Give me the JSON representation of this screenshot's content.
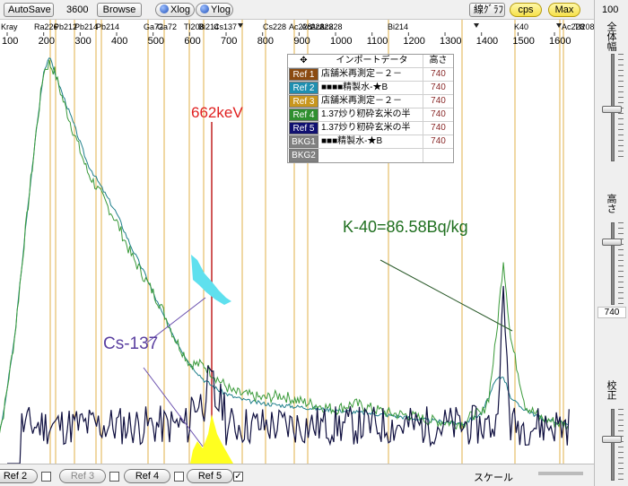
{
  "toolbar": {
    "autosave": "AutoSave",
    "time_value": "3600",
    "browse": "Browse",
    "xlog": "Xlog",
    "ylog": "Ylog",
    "line_graph": "線ｸﾞﾗﾌ",
    "cps": "cps",
    "max": "Max"
  },
  "axis": {
    "ticks": [
      "100",
      "200",
      "300",
      "400",
      "500",
      "600",
      "700",
      "800",
      "900",
      "1000",
      "1100",
      "1200",
      "1300",
      "1400",
      "1500",
      "1600"
    ],
    "top_labels": [
      "Kray",
      "Ra226",
      "Pb212",
      "Pb214",
      "Pb214",
      "Ga72",
      "Ga72",
      "Tl208",
      "Bi214",
      "Cs137",
      "Cs228",
      "Ac228",
      "Ac228",
      "Ac228",
      "Ac228",
      "Bi214",
      "K40",
      "Ac228",
      "Tl208"
    ]
  },
  "table": {
    "header": {
      "col0": "✥",
      "col1": "インポートデータ",
      "col2": "高さ"
    },
    "rows": [
      {
        "ref": "Ref 1",
        "name": "店舗米再測定－２－",
        "height": "740",
        "color": "#8b4a10"
      },
      {
        "ref": "Ref 2",
        "name": "■■■■精製水-★B",
        "height": "740",
        "color": "#1f8fb0"
      },
      {
        "ref": "Ref 3",
        "name": "店舗米再測定－２－",
        "height": "740",
        "color": "#c8961e"
      },
      {
        "ref": "Ref 4",
        "name": "1.37炒り籾砕玄米の半",
        "height": "740",
        "color": "#2f8f2f"
      },
      {
        "ref": "Ref 5",
        "name": "1.37炒り籾砕玄米の半",
        "height": "740",
        "color": "#101070"
      },
      {
        "ref": "BKG1",
        "name": "■■■精製水-★B",
        "height": "740",
        "color": "#808080"
      },
      {
        "ref": "BKG2",
        "name": "",
        "height": "",
        "color": "#808080"
      }
    ]
  },
  "annotations": {
    "peak_662": "662keV",
    "k40": "K-40=86.58Bq/kg",
    "cs137": "Cs-137"
  },
  "right_panel": {
    "top_value": "100",
    "zoom_label": "全体幅",
    "height_label": "高さ",
    "height_value": "740",
    "calib_label": "校正"
  },
  "bottom": {
    "tabs": [
      "Ref 2",
      "Ref 3",
      "Ref 4",
      "Ref 5"
    ],
    "ref5_checked": "✓",
    "scale_label": "スケール"
  },
  "chart_data": {
    "type": "line",
    "xlim": [
      65,
      1650
    ],
    "ylim": [
      0,
      495
    ],
    "series": [
      {
        "values_x": [
          65,
          90,
          120,
          150,
          180,
          200,
          215,
          230,
          250,
          280,
          320,
          360,
          400,
          440,
          480,
          520,
          560,
          600,
          640,
          680,
          720,
          760,
          800,
          850,
          900,
          950,
          1000,
          1050,
          1100,
          1150,
          1200,
          1250,
          1300,
          1350,
          1380,
          1400,
          1420,
          1440,
          1460,
          1480,
          1500,
          1520,
          1560,
          1600,
          1640
        ],
        "values": [
          10,
          60,
          150,
          280,
          400,
          470,
          480,
          470,
          440,
          400,
          350,
          320,
          290,
          250,
          220,
          190,
          150,
          120,
          118,
          100,
          85,
          82,
          78,
          82,
          75,
          70,
          65,
          72,
          66,
          60,
          58,
          52,
          50,
          48,
          60,
          58,
          80,
          150,
          245,
          150,
          110,
          70,
          55,
          50,
          45
        ]
      },
      {
        "values_x": [
          65,
          90,
          120,
          150,
          180,
          200,
          215,
          230,
          250,
          280,
          320,
          360,
          400,
          440,
          480,
          520,
          560,
          600,
          640,
          680,
          720,
          760,
          800,
          850,
          900,
          950,
          1000,
          1050,
          1100,
          1150,
          1200,
          1250,
          1300,
          1350,
          1400,
          1440,
          1460,
          1480,
          1500,
          1560,
          1600,
          1640
        ],
        "values": [
          10,
          60,
          150,
          280,
          400,
          470,
          488,
          470,
          445,
          410,
          360,
          330,
          300,
          260,
          225,
          185,
          150,
          120,
          100,
          88,
          80,
          75,
          72,
          70,
          68,
          66,
          64,
          62,
          60,
          58,
          55,
          52,
          50,
          48,
          60,
          100,
          105,
          80,
          70,
          55,
          50,
          48
        ]
      }
    ]
  }
}
